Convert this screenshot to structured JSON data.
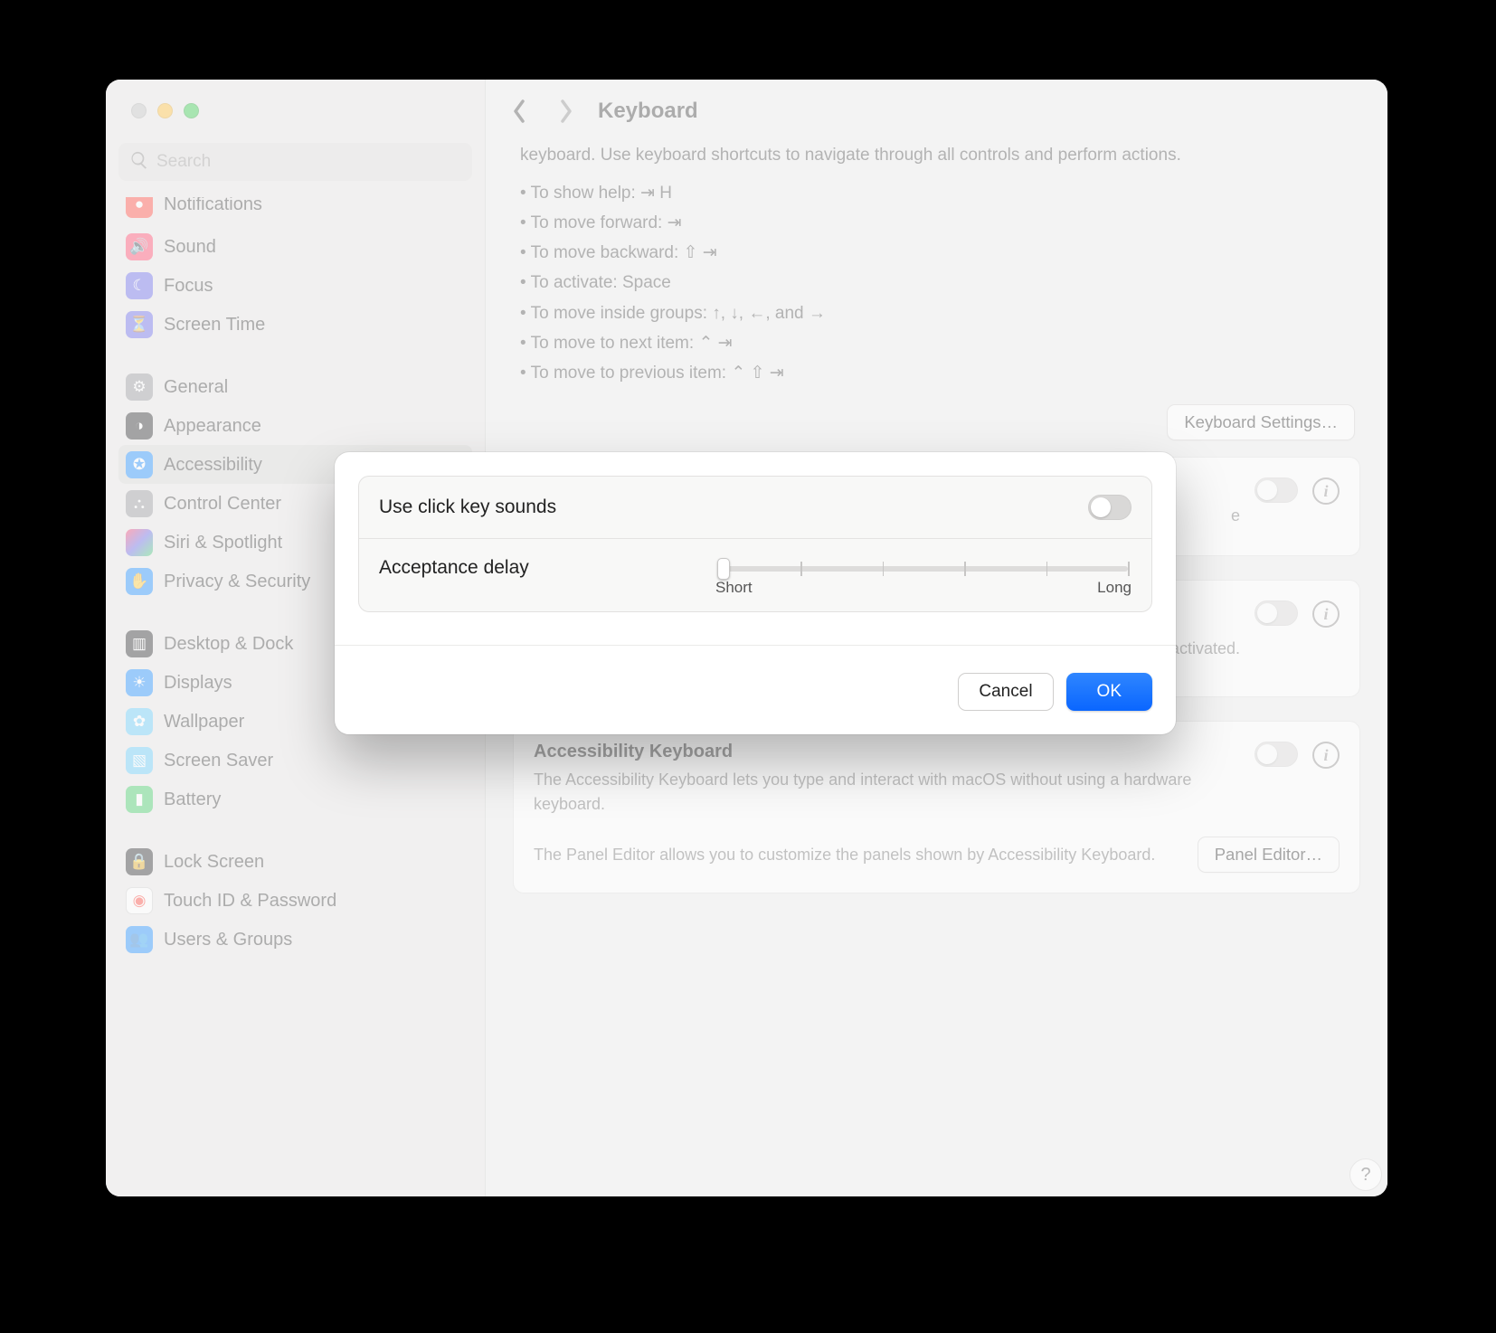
{
  "page_title": "Keyboard",
  "search": {
    "placeholder": "Search"
  },
  "sidebar": {
    "items": [
      {
        "label": "Notifications"
      },
      {
        "label": "Sound"
      },
      {
        "label": "Focus"
      },
      {
        "label": "Screen Time"
      },
      {
        "label": "General"
      },
      {
        "label": "Appearance"
      },
      {
        "label": "Accessibility"
      },
      {
        "label": "Control Center"
      },
      {
        "label": "Siri & Spotlight"
      },
      {
        "label": "Privacy & Security"
      },
      {
        "label": "Desktop & Dock"
      },
      {
        "label": "Displays"
      },
      {
        "label": "Wallpaper"
      },
      {
        "label": "Screen Saver"
      },
      {
        "label": "Battery"
      },
      {
        "label": "Lock Screen"
      },
      {
        "label": "Touch ID & Password"
      },
      {
        "label": "Users & Groups"
      }
    ]
  },
  "content": {
    "intro": "keyboard. Use keyboard shortcuts to navigate through all controls and perform actions.",
    "bullets": [
      "To show help: ⇥ H",
      "To move forward: ⇥",
      "To move backward: ⇧ ⇥",
      "To activate: Space",
      "To move inside groups: ↑, ↓, ←, and →",
      "To move to next item: ⌃ ⇥",
      "To move to previous item: ⌃ ⇧ ⇥"
    ],
    "kb_settings_btn": "Keyboard Settings…",
    "slow_keys": {
      "desc_fragment_a": "e",
      "desc_fragment_b": "ed and when it is activated."
    },
    "accessibility_keyboard": {
      "title": "Accessibility Keyboard",
      "desc": "The Accessibility Keyboard lets you type and interact with macOS without using a hardware keyboard.",
      "panel_desc": "The Panel Editor allows you to customize the panels shown by Accessibility Keyboard.",
      "panel_btn": "Panel Editor…"
    },
    "help_glyph": "?"
  },
  "modal": {
    "click_sounds_label": "Use click key sounds",
    "click_sounds_on": false,
    "acceptance_label": "Acceptance delay",
    "slider": {
      "min_label": "Short",
      "max_label": "Long",
      "value_pct": 0,
      "ticks": 6
    },
    "cancel": "Cancel",
    "ok": "OK"
  }
}
